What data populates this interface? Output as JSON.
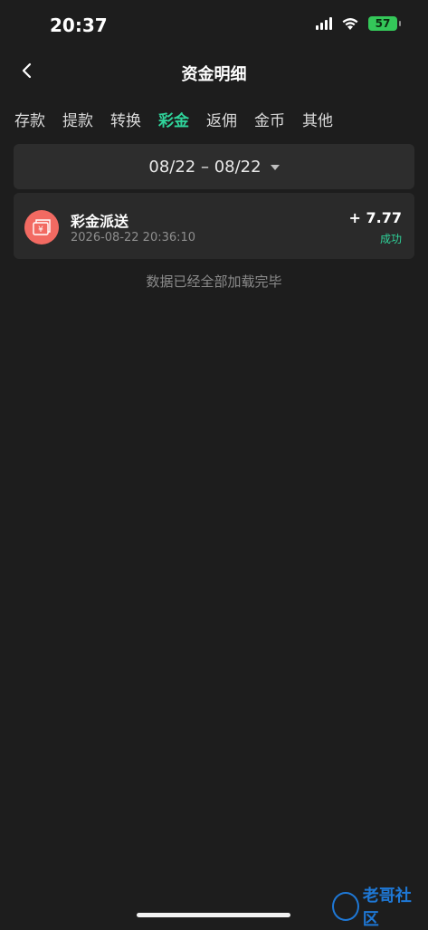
{
  "status": {
    "time": "20:37",
    "battery": "57"
  },
  "nav": {
    "title": "资金明细"
  },
  "tabs": [
    {
      "label": "存款"
    },
    {
      "label": "提款"
    },
    {
      "label": "转换"
    },
    {
      "label": "彩金",
      "active": true
    },
    {
      "label": "返佣"
    },
    {
      "label": "金币"
    },
    {
      "label": "其他"
    }
  ],
  "date_filter": {
    "range": "08/22 – 08/22"
  },
  "records": [
    {
      "name": "彩金派送",
      "time": "2026-08-22 20:36:10",
      "amount": "+ 7.77",
      "status": "成功"
    }
  ],
  "footer": {
    "end_text": "数据已经全部加载完毕"
  },
  "watermark": {
    "text": "老哥社区"
  },
  "colors": {
    "accent": "#2fd39a",
    "background": "#1d1d1d",
    "record_icon": "#f26a62"
  }
}
